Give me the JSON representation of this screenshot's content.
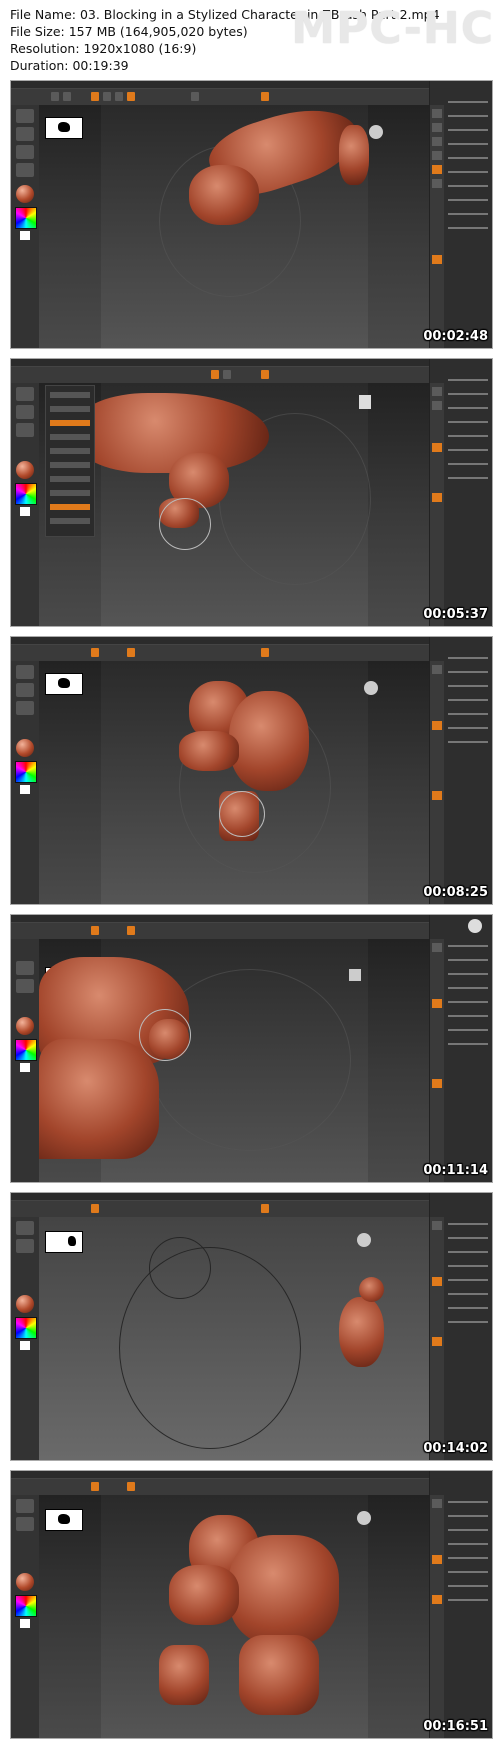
{
  "header": {
    "file_name": "File Name: 03. Blocking in a Stylized Character in ZBrush Part 2.mp4",
    "file_size": "File Size: 157 MB (164,905,020 bytes)",
    "resolution": "Resolution: 1920x1080 (16:9)",
    "duration": "Duration: 00:19:39",
    "watermark": "MPC-HC"
  },
  "frames": [
    {
      "timestamp": "00:02:48"
    },
    {
      "timestamp": "00:05:37"
    },
    {
      "timestamp": "00:08:25"
    },
    {
      "timestamp": "00:11:14"
    },
    {
      "timestamp": "00:14:02"
    },
    {
      "timestamp": "00:16:51"
    }
  ],
  "colors": {
    "accent": "#e07a1b",
    "model": "#a2452b",
    "ui_bg": "#2e2e2e"
  },
  "icons": [
    "material-ball-icon",
    "color-picker-icon",
    "navigation-cube-icon",
    "transpose-gizmo-icon"
  ]
}
